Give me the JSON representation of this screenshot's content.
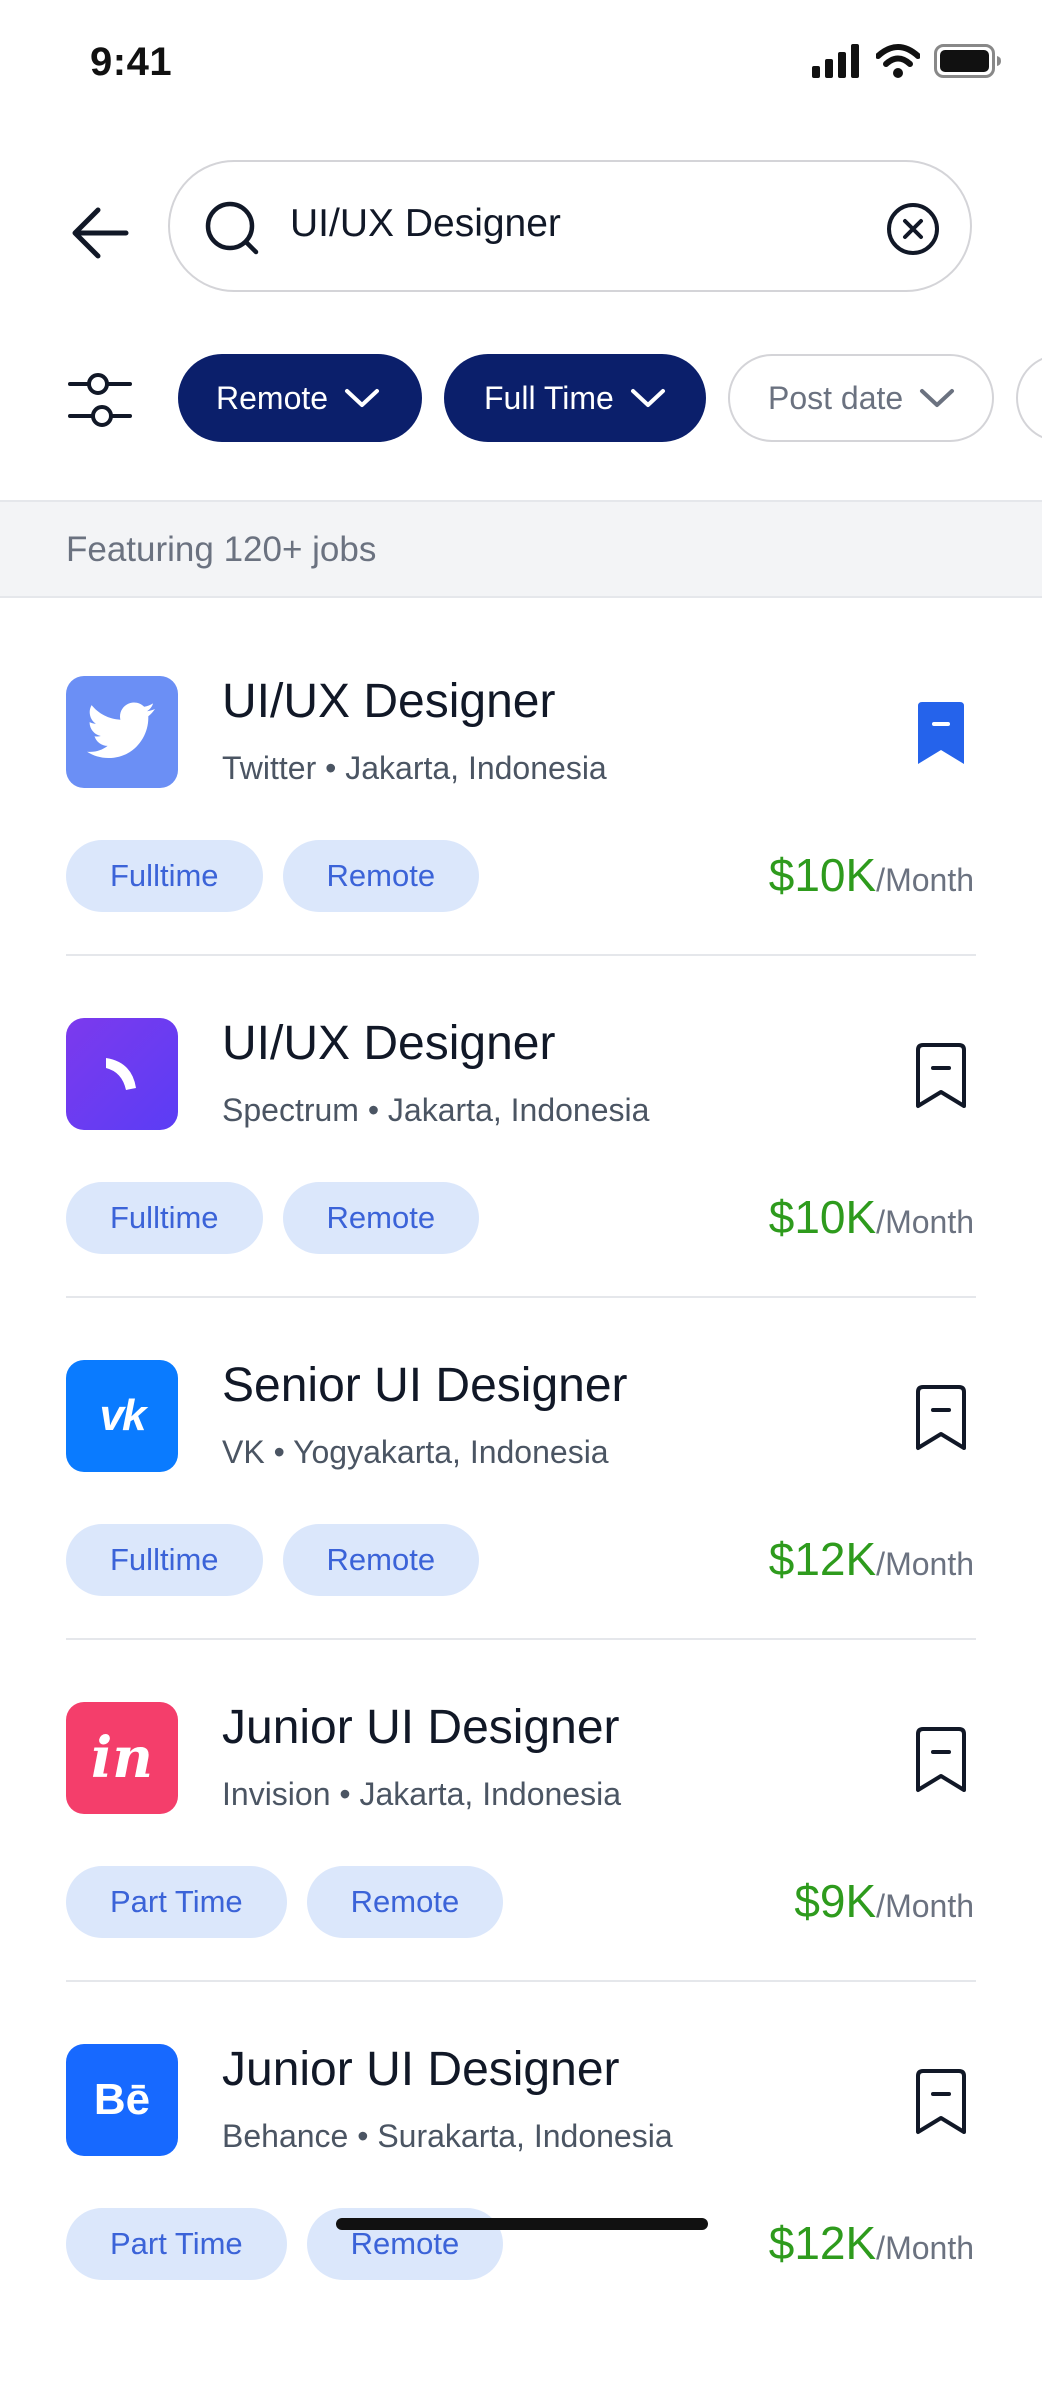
{
  "status_bar": {
    "time": "9:41"
  },
  "search": {
    "value": "UI/UX Designer"
  },
  "filters": [
    {
      "label": "Remote",
      "active": true
    },
    {
      "label": "Full Time",
      "active": true
    },
    {
      "label": "Post date",
      "active": false
    }
  ],
  "featuring": {
    "text": "Featuring 120+ jobs"
  },
  "jobs": [
    {
      "title": "UI/UX Designer",
      "company": "Twitter",
      "location": "Jakarta, Indonesia",
      "meta": "Twitter • Jakarta, Indonesia",
      "tags": [
        "Fulltime",
        "Remote"
      ],
      "salary": "$10K",
      "period": "/Month",
      "saved": true,
      "logo_icon": "twitter-logo-icon",
      "logo_color": "#6b8ff5"
    },
    {
      "title": "UI/UX Designer",
      "company": "Spectrum",
      "location": "Jakarta, Indonesia",
      "meta": "Spectrum • Jakarta, Indonesia",
      "tags": [
        "Fulltime",
        "Remote"
      ],
      "salary": "$10K",
      "period": "/Month",
      "saved": false,
      "logo_icon": "spectrum-logo-icon",
      "logo_color": "#6c3bf0"
    },
    {
      "title": "Senior UI Designer",
      "company": "VK",
      "location": "Yogyakarta, Indonesia",
      "meta": "VK • Yogyakarta, Indonesia",
      "tags": [
        "Fulltime",
        "Remote"
      ],
      "salary": "$12K",
      "period": "/Month",
      "saved": false,
      "logo_icon": "vk-logo-icon",
      "logo_color": "#0a7bff",
      "logo_text": "vk"
    },
    {
      "title": "Junior UI Designer",
      "company": "Invision",
      "location": "Jakarta, Indonesia",
      "meta": "Invision • Jakarta, Indonesia",
      "tags": [
        "Part Time",
        "Remote"
      ],
      "salary": "$9K",
      "period": "/Month",
      "saved": false,
      "logo_icon": "invision-logo-icon",
      "logo_color": "#f43e6b",
      "logo_text": "in"
    },
    {
      "title": "Junior UI Designer",
      "company": "Behance",
      "location": "Surakarta, Indonesia",
      "meta": "Behance • Surakarta, Indonesia",
      "tags": [
        "Part Time",
        "Remote"
      ],
      "salary": "$12K",
      "period": "/Month",
      "saved": false,
      "logo_icon": "behance-logo-icon",
      "logo_color": "#1769ff",
      "logo_text": "Bē"
    }
  ],
  "colors": {
    "primary": "#0b1f6b",
    "accent_blue": "#2563eb",
    "salary_green": "#2e9b1d",
    "tag_bg": "#dbe7fb",
    "tag_text": "#3b63d8"
  }
}
